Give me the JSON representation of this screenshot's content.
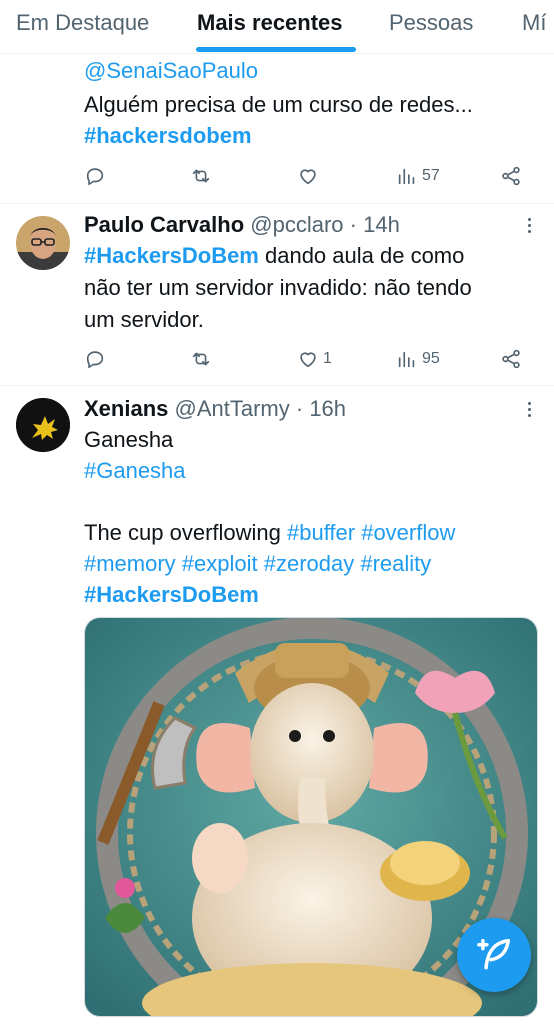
{
  "tabs": [
    {
      "label": "Em Destaque",
      "active": false
    },
    {
      "label": "Mais recentes",
      "active": true
    },
    {
      "label": "Pessoas",
      "active": false
    },
    {
      "label": "Mí",
      "active": false
    }
  ],
  "posts": [
    {
      "lines": [
        "@SenaiSaoPaulo",
        "Alguém precisa de um curso de redes...",
        "#hackersdobem"
      ],
      "views": "57"
    },
    {
      "name": "Paulo Carvalho",
      "handle": "@pcclaro",
      "time": "14h",
      "hashtag": "#HackersDoBem",
      "text_line1_rest": " dando aula de como",
      "text_line2": "não ter um servidor invadido: não tendo",
      "text_line3": "um servidor.",
      "likes": "1",
      "views": "95"
    },
    {
      "name": "Xenians",
      "handle": "@AntTarmy",
      "time": "16h",
      "line1": "Ganesha",
      "line2": "#Ganesha",
      "line3_text": "The cup overflowing ",
      "line3_tags": "#buffer #overflow",
      "line4": "#memory #exploit #zeroday #reality",
      "line5": "#HackersDoBem"
    }
  ],
  "separator": " · ",
  "colors": {
    "accent": "#1d9bf0",
    "muted": "#536471",
    "text": "#0f1419"
  },
  "icons": [
    "reply-icon",
    "repost-icon",
    "like-icon",
    "views-icon",
    "share-icon",
    "more-icon",
    "compose-icon"
  ]
}
